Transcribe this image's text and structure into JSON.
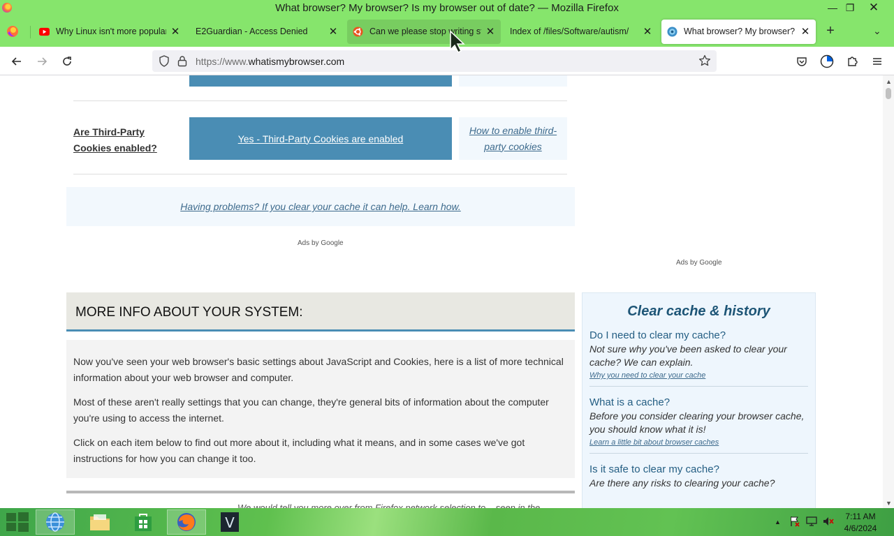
{
  "window": {
    "title": "What browser? My browser? Is my browser out of date? — Mozilla Firefox",
    "minimize": "—",
    "restore": "❐",
    "close": "✕"
  },
  "tabs": [
    {
      "label": "Why Linux isn't more popular -",
      "icon": "youtube-icon",
      "state": "normal"
    },
    {
      "label": "E2Guardian - Access Denied",
      "icon": "none",
      "state": "normal"
    },
    {
      "label": "Can we please stop writing stu",
      "icon": "ubuntu-icon",
      "state": "hovered"
    },
    {
      "label": "Index of /files/Software/autism/",
      "icon": "none",
      "state": "normal"
    },
    {
      "label": "What browser? My browser? Is m",
      "icon": "whatismybrowser-icon",
      "state": "active"
    }
  ],
  "tab_close_glyph": "✕",
  "newtab_glyph": "+",
  "tablist_glyph": "⌄",
  "urlbar": {
    "prefix": "https://www.",
    "domain": "whatismybrowser.com"
  },
  "page": {
    "cookies_label": "Are Third-Party Cookies enabled?",
    "cookies_status": "Yes - Third-Party Cookies are enabled",
    "cookies_help": "How to enable third-party cookies",
    "problem_link": "Having problems? If you clear your cache it can help. Learn how.",
    "ads_left": "Ads by Google",
    "ads_right": "Ads by Google",
    "moreinfo_heading": "MORE INFO ABOUT YOUR SYSTEM:",
    "moreinfo_paragraphs": [
      "Now you've seen your web browser's basic settings about JavaScript and Cookies, here is a list of more technical information about your web browser and computer.",
      "Most of these aren't really settings that you can change, they're general bits of information about the computer you're using to access the internet.",
      "Click on each item below to find out more about it, including what it means, and in some cases we've got instructions for how you can change it too."
    ],
    "moreinfo_cut": "We would tell you more over from Firefox network selection to ...seen in the"
  },
  "side_panel": {
    "title": "Clear cache & history",
    "items": [
      {
        "q": "Do I need to clear my cache?",
        "d": "Not sure why you've been asked to clear your cache? We can explain.",
        "link": "Why you need to clear your cache"
      },
      {
        "q": "What is a cache?",
        "d": "Before you consider clearing your browser cache, you should know what it is!",
        "link": "Learn a little bit about browser caches"
      },
      {
        "q": "Is it safe to clear my cache?",
        "d": "Are there any risks to clearing your cache?",
        "link": ""
      }
    ]
  },
  "taskbar": {
    "apps": [
      "internet-explorer",
      "file-explorer",
      "store",
      "firefox",
      "vim"
    ],
    "clock_time": "7:11 AM",
    "clock_date": "4/6/2024",
    "tray_arrow": "▲"
  },
  "colors": {
    "chrome_green": "#86e56c",
    "accent_blue": "#4a8db4",
    "link_blue": "#3d6a8c"
  }
}
